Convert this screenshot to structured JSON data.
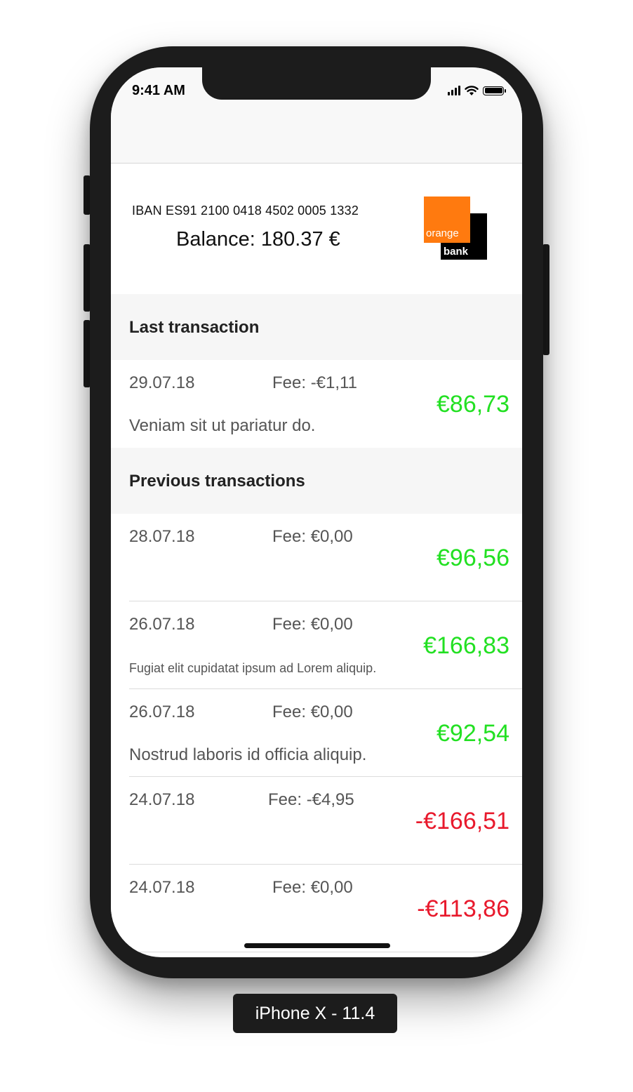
{
  "status_bar": {
    "time": "9:41 AM",
    "signal_icon": "signal-icon",
    "wifi_icon": "wifi-icon",
    "battery_icon": "battery-icon"
  },
  "account": {
    "iban": "IBAN ES91 2100 0418 4502 0005 1332",
    "balance": "Balance: 180.37 €",
    "logo": {
      "top_text": "orange",
      "bottom_text": "bank",
      "brand_color": "#ff7a0f"
    }
  },
  "last_section": {
    "title": "Last transaction",
    "items": [
      {
        "date": "29.07.18",
        "fee": "Fee: -€1,11",
        "amount": "€86,73",
        "description": "Veniam sit ut pariatur do.",
        "color": "#22e022"
      }
    ]
  },
  "previous_section": {
    "title": "Previous transactions",
    "items": [
      {
        "date": "28.07.18",
        "fee": "Fee: €0,00",
        "amount": "€96,56",
        "description": "",
        "color": "#22e022"
      },
      {
        "date": "26.07.18",
        "fee": "Fee: €0,00",
        "amount": "€166,83",
        "description": "Fugiat elit cupidatat ipsum ad Lorem aliquip.",
        "color": "#22e022"
      },
      {
        "date": "26.07.18",
        "fee": "Fee: €0,00",
        "amount": "€92,54",
        "description": "Nostrud laboris id officia aliquip.",
        "color": "#22e022"
      },
      {
        "date": "24.07.18",
        "fee": "Fee: -€4,95",
        "amount": "-€166,51",
        "description": "",
        "color": "#e8192c"
      },
      {
        "date": "24.07.18",
        "fee": "Fee: €0,00",
        "amount": "-€113,86",
        "description": "",
        "color": "#e8192c"
      }
    ]
  },
  "device_label": "iPhone X - 11.4"
}
